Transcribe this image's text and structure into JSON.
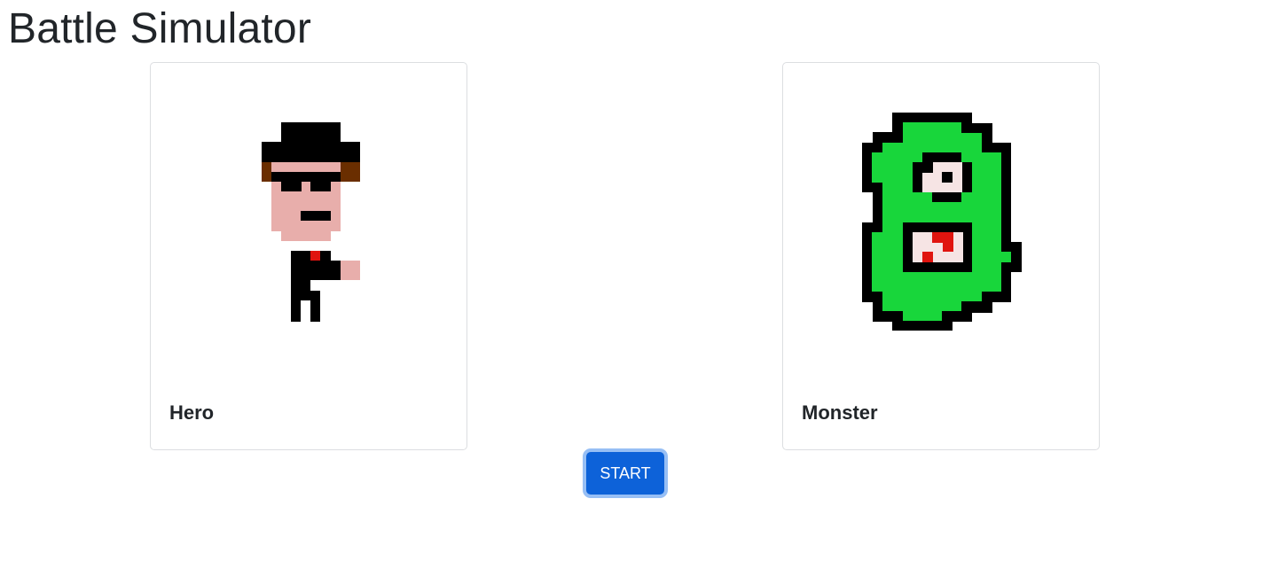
{
  "page": {
    "title": "Battle Simulator"
  },
  "cards": {
    "hero": {
      "title": "Hero"
    },
    "monster": {
      "title": "Monster"
    }
  },
  "controls": {
    "start_label": "START"
  },
  "colors": {
    "button": "#0d62d9",
    "button_focus_ring": "#97bff5",
    "monster_green": "#18d63b",
    "hero_skin": "#e8aeab",
    "hero_hair": "#6a2e00",
    "tie_red": "#e0140f"
  }
}
